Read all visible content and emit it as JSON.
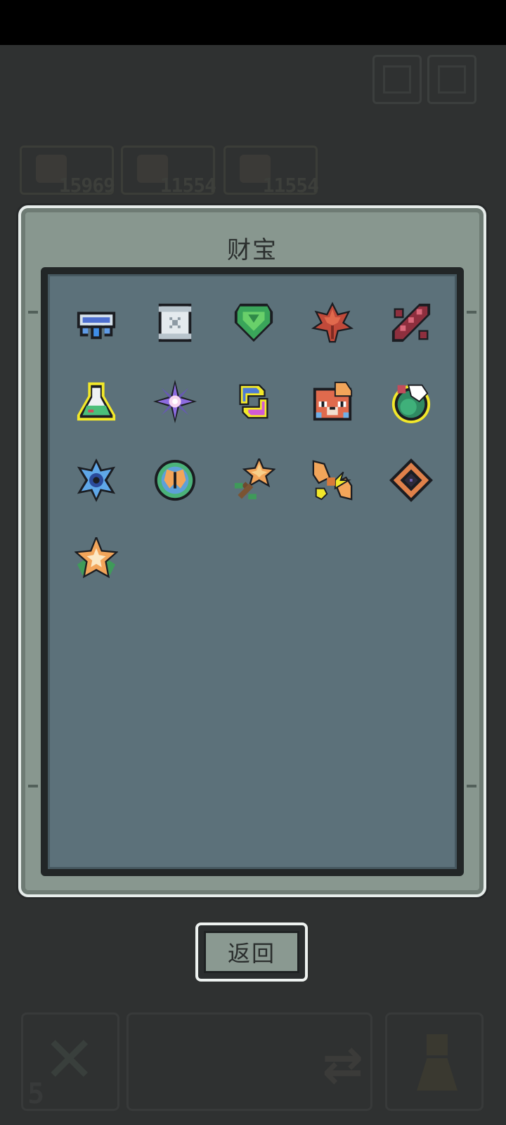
{
  "dialog": {
    "title": "财宝",
    "back_label": "返回"
  },
  "hud": {
    "resources": [
      {
        "icon": "maple-leaf-icon",
        "value": "15969"
      },
      {
        "icon": "character-portrait-icon",
        "value": "11554"
      },
      {
        "icon": "creature-icon",
        "value": "11554"
      }
    ],
    "bottom": {
      "count": "5"
    }
  },
  "treasures": [
    {
      "name": "blue-orb-amulet",
      "icon": "amulet-icon"
    },
    {
      "name": "ancient-scroll",
      "icon": "scroll-icon"
    },
    {
      "name": "green-gem-shield",
      "icon": "gem-shield-icon"
    },
    {
      "name": "red-maple-leaf",
      "icon": "maple-leaf-icon"
    },
    {
      "name": "crimson-dna-helix",
      "icon": "helix-icon"
    },
    {
      "name": "green-potion-flask",
      "icon": "potion-flask-icon"
    },
    {
      "name": "violet-star-flower",
      "icon": "star-flower-icon"
    },
    {
      "name": "crescent-swirl-charm",
      "icon": "swirl-charm-icon"
    },
    {
      "name": "red-panda-mask",
      "icon": "animal-mask-icon"
    },
    {
      "name": "green-ball-orb",
      "icon": "orb-icon"
    },
    {
      "name": "blue-cog-flower",
      "icon": "cog-flower-icon"
    },
    {
      "name": "butterfly-medallion",
      "icon": "butterfly-medallion-icon"
    },
    {
      "name": "star-wand",
      "icon": "star-wand-icon"
    },
    {
      "name": "orange-bow-ribbon",
      "icon": "bow-ribbon-icon"
    },
    {
      "name": "dark-diamond-rune",
      "icon": "diamond-rune-icon"
    },
    {
      "name": "orange-star-leaf",
      "icon": "star-leaf-icon"
    }
  ]
}
